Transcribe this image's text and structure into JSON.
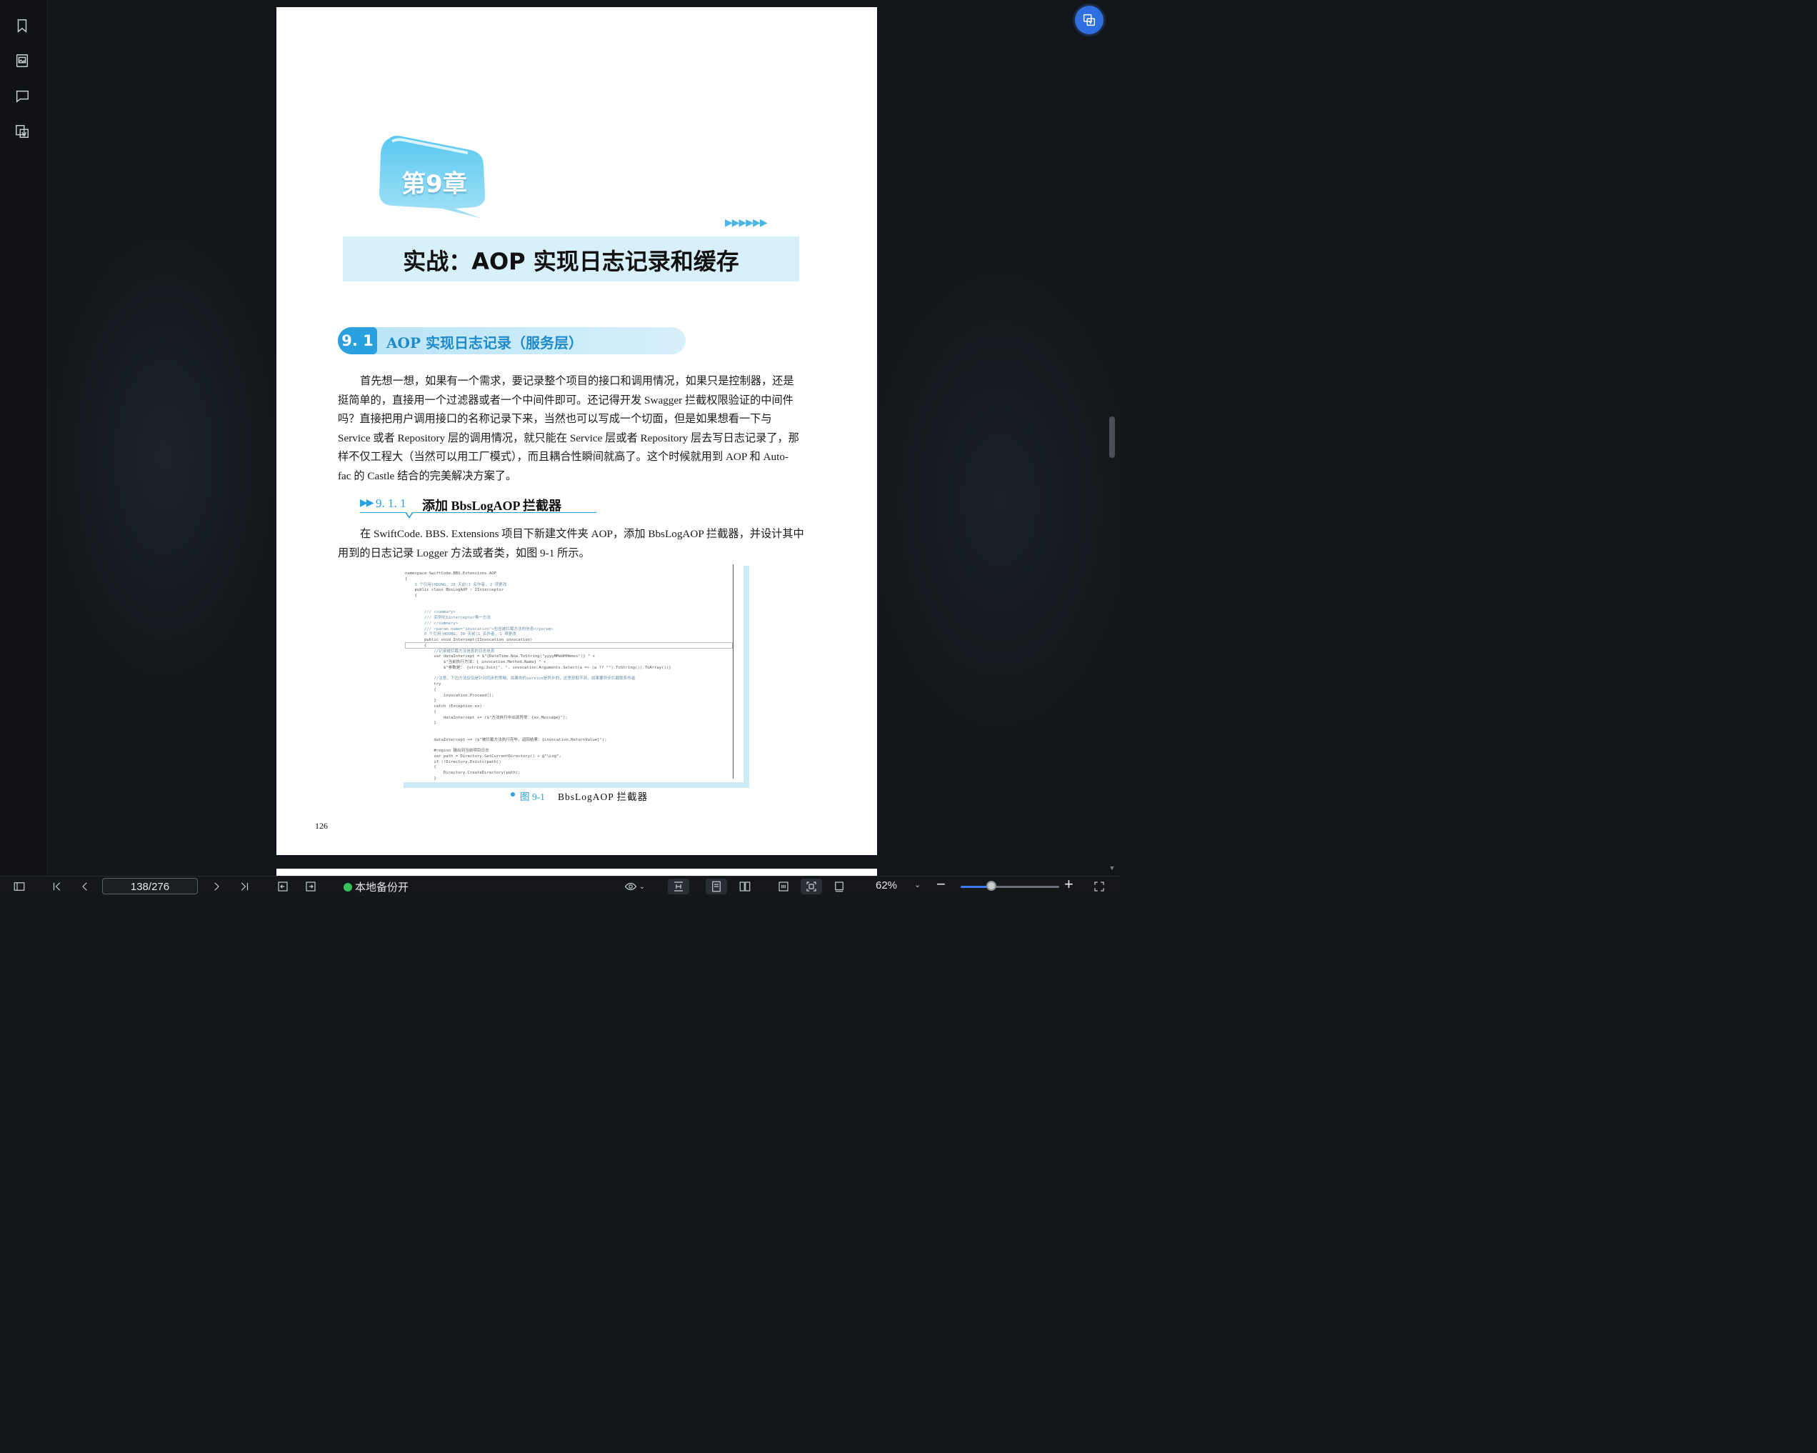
{
  "sidebar": {
    "items": [
      {
        "icon": "bookmark-icon"
      },
      {
        "icon": "thumbnail-icon"
      },
      {
        "icon": "comment-icon"
      },
      {
        "icon": "export-icon"
      }
    ]
  },
  "floating_button": {
    "icon": "translate-icon"
  },
  "document": {
    "chapter_label": "第9章",
    "chapter_arrows": "▶▶▶▶▶▶",
    "chapter_title": "实战：AOP 实现日志记录和缓存",
    "section_number": "9. 1",
    "section_title": "AOP 实现日志记录（服务层）",
    "paragraph1": [
      "首先想一想，如果有一个需求，要记录整个项目的接口和调用情况，如果只是控制器，还是",
      "挺简单的，直接用一个过滤器或者一个中间件即可。还记得开发 Swagger 拦截权限验证的中间件",
      "吗？直接把用户调用接口的名称记录下来，当然也可以写成一个切面，但是如果想看一下与",
      "Service 或者 Repository 层的调用情况，就只能在 Service 层或者 Repository 层去写日志记录了，那",
      "样不仅工程大（当然可以用工厂模式），而且耦合性瞬间就高了。这个时候就用到 AOP 和 Auto-",
      "fac 的 Castle 结合的完美解决方案了。"
    ],
    "subsection_arrow": "▶▶",
    "subsection_number": "9. 1. 1",
    "subsection_title": "添加 BbsLogAOP 拦截器",
    "paragraph2": [
      "在 SwiftCode. BBS. Extensions 项目下新建文件夹 AOP，添加 BbsLogAOP 拦截器，并设计其中",
      "用到的日志记录 Logger 方法或者类，如图 9-1 所示。"
    ],
    "code_lines": [
      "namespace SwiftCode.BBS.Extensions.AOP",
      "{",
      "    3 个引用|HDONG, 28 天前|1 名作者, 2 项更改",
      "    public class BbsLogAOP : IInterceptor",
      "    {",
      "",
      "",
      "        /// <summary>",
      "        /// 实例化IInterceptor唯一方法",
      "        /// </summary>",
      "        /// <param name=\"invocation\">包含被拦截方法的信息</param>",
      "        0 个引用|HDONG, 30 天前|1 名作者, 1 项更改",
      "        public void Intercept(IInvocation invocation)",
      "        {",
      "            //记录被拦截方法信息的日志信息",
      "            var dataIntercept = $\"{DateTime.Now.ToString(\"yyyyMMddHHmmss\")} \" +",
      "                $\"当前执行方法：{ invocation.Method.Name} \" +",
      "                $\"参数是： {string.Join(\", \", invocation.Arguments.Select(a => (a ?? \"\").ToString()).ToArray())}",
      "",
      "            //注意，下边方法仅仅是针对同步的策略，如果你的service是异步的，这里获取不到，如果要异步拦截联系作者",
      "            try",
      "            {",
      "                invocation.Proceed();",
      "            }",
      "            catch (Exception ex)",
      "            {",
      "                dataIntercept += ($\"方法执行中出现异常：{ex.Message}\");",
      "            }",
      "",
      "",
      "            dataIntercept += ($\"被拦截方法执行完毕，返回结果：{invocation.ReturnValue}\");",
      "",
      "            #region 输出到当前项目日志",
      "            var path = Directory.GetCurrentDirectory() + @\"\\Log\";",
      "            if (!Directory.Exists(path))",
      "            {",
      "                Directory.CreateDirectory(path);",
      "            }"
    ],
    "figure_label": "图 9-1",
    "figure_caption": "BbsLogAOP 拦截器",
    "page_number": "126"
  },
  "toolbar": {
    "page_indicator": "138/276",
    "backup_label": "本地备份开",
    "zoom_label": "62%",
    "zoom_fraction": 0.31,
    "accent_color": "#3a7bf0",
    "backup_status_color": "#37c35c"
  }
}
